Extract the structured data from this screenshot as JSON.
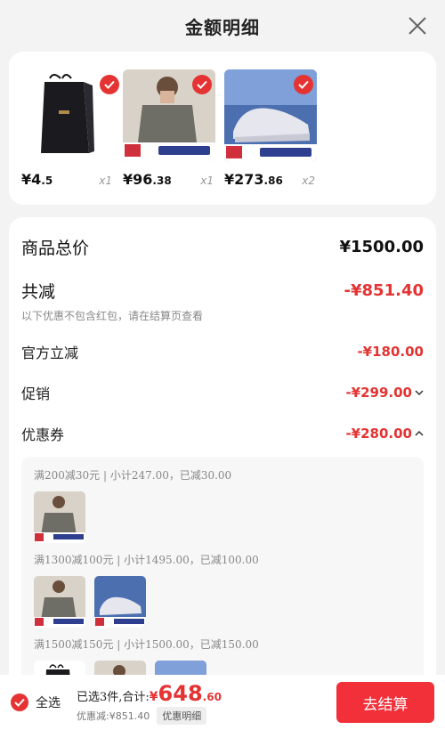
{
  "header": {
    "title": "金额明细"
  },
  "products": [
    {
      "price_int": "¥4",
      "price_dec": ".5",
      "qty": "x1"
    },
    {
      "price_int": "¥96",
      "price_dec": ".38",
      "qty": "x1"
    },
    {
      "price_int": "¥273",
      "price_dec": ".86",
      "qty": "x2"
    }
  ],
  "summary": {
    "total_label": "商品总价",
    "total_value": "¥1500.00",
    "reduce_label": "共减",
    "reduce_value": "-¥851.40",
    "note": "以下优惠不包含红包，请在结算页查看",
    "official_label": "官方立减",
    "official_value": "-¥180.00",
    "promo_label": "促销",
    "promo_value": "-¥299.00",
    "coupon_label": "优惠券",
    "coupon_value": "-¥280.00"
  },
  "coupons": [
    {
      "text": "满200减30元 | 小计247.00，已减30.00"
    },
    {
      "text": "满1300减100元 | 小计1495.00，已减100.00"
    },
    {
      "text": "满1500减150元 | 小计1500.00，已减150.00"
    }
  ],
  "bottom": {
    "select_all": "全选",
    "selected": "已选3件,合计:",
    "yen": "¥",
    "total_int": "648",
    "total_dec": ".60",
    "discount": "优惠减:¥851.40",
    "detail": "优惠明细",
    "checkout": "去结算"
  },
  "colors": {
    "accent": "#e53333",
    "checkout": "#f2303a"
  }
}
